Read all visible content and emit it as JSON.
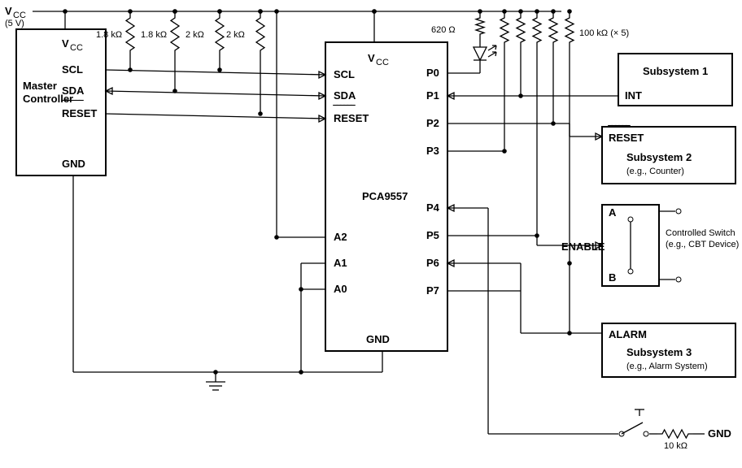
{
  "power": {
    "label": "V",
    "sub": "CC",
    "voltage": "(5 V)"
  },
  "master": {
    "title": "Master\nController",
    "pins": {
      "vcc": "V",
      "vcc_sub": "CC",
      "scl": "SCL",
      "sda": "SDA",
      "reset": "RESET",
      "gnd": "GND"
    }
  },
  "pullups": {
    "r1": "1.8 kΩ",
    "r2": "1.8 kΩ",
    "r3": "2 kΩ",
    "r4": "2 kΩ",
    "rled": "620 Ω",
    "r100": "100 kΩ (× 5)",
    "r10": "10 kΩ"
  },
  "chip": {
    "name": "PCA9557",
    "pins": {
      "vcc": "V",
      "vcc_sub": "CC",
      "scl": "SCL",
      "sda": "SDA",
      "reset": "RESET",
      "gnd": "GND",
      "a0": "A0",
      "a1": "A1",
      "a2": "A2",
      "p0": "P0",
      "p1": "P1",
      "p2": "P2",
      "p3": "P3",
      "p4": "P4",
      "p5": "P5",
      "p6": "P6",
      "p7": "P7"
    }
  },
  "sub1": {
    "title": "Subsystem 1",
    "pin": "INT"
  },
  "sub2": {
    "title": "Subsystem 2",
    "desc": "(e.g., Counter)",
    "pin": "RESET"
  },
  "switch": {
    "a": "A",
    "b": "B",
    "enable": "ENABLE",
    "title": "Controlled Switch",
    "desc": "(e.g., CBT Device)"
  },
  "sub3": {
    "title": "Subsystem 3",
    "desc": "(e.g., Alarm System)",
    "pin": "ALARM"
  },
  "gnd": "GND",
  "overline": "‾‾‾‾‾‾"
}
